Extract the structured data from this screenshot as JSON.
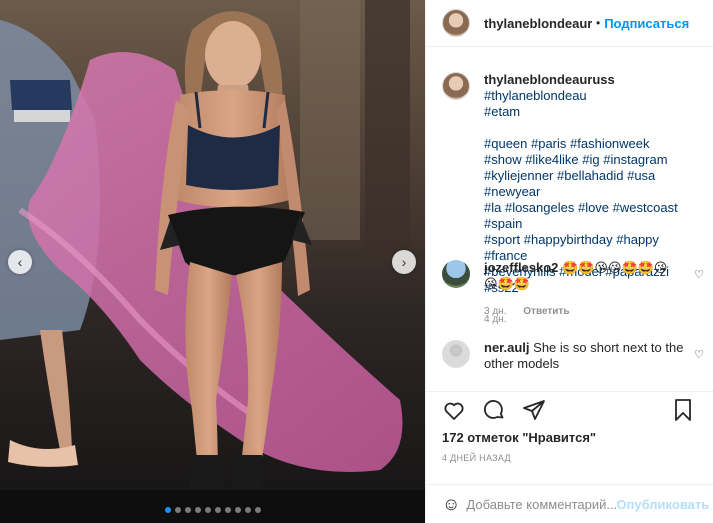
{
  "post": {
    "author": "thylaneblondeauruss",
    "author_truncated": "thylaneblondeaurι",
    "follow_label": "Подписаться",
    "header_separator": "•",
    "more_label": "···"
  },
  "caption": {
    "username": "thylaneblondeauruss",
    "lines": [
      "#thylaneblondeau",
      "#etam"
    ],
    "hashtag_block": [
      "#queen #paris #fashionweek",
      "#show #like4like #ig #instagram",
      "#kyliejenner #bellahadid #usa #newyear",
      "#la #losangeles #love #westcoast #spain",
      "#sport #happybirthday #happy #france",
      "#beverlyhills #model #paparazzi #ss22"
    ],
    "time": "4 дн."
  },
  "comments": [
    {
      "username": "jozefflesko2",
      "text": "🤩🤩😘😘🤩🤩😘 😘🤩🤩",
      "time": "3 дн.",
      "reply_label": "Ответить"
    },
    {
      "username": "ner.aulj",
      "text": "She is so short next to the other models"
    }
  ],
  "actions": {
    "likes": "172 отметок \"Нравится\"",
    "posted_ago": "4 ДНЕЙ НАЗАД",
    "comment_placeholder": "Добавьте комментарий...",
    "publish_label": "Опубликовать",
    "emoji_icon": "smiley-icon"
  },
  "carousel": {
    "prev_icon": "chevron-left-icon",
    "next_icon": "chevron-right-icon",
    "prev_glyph": "‹",
    "next_glyph": "›",
    "slide_count": 10,
    "active_index": 0,
    "active_color": "#1e90ff"
  },
  "colors": {
    "accent": "#0095f6",
    "link": "#00376b",
    "muted": "#8e8e8e"
  }
}
